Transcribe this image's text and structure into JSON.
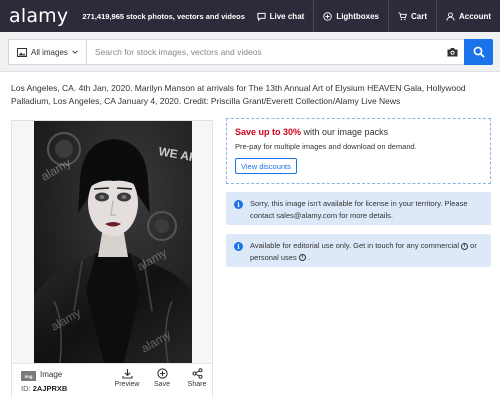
{
  "header": {
    "logo": "alamy",
    "tagline": "271,419,965 stock photos, vectors and videos",
    "links": [
      {
        "label": "Live chat",
        "icon": "chat-icon"
      },
      {
        "label": "Lightboxes",
        "icon": "plus-circle-icon"
      },
      {
        "label": "Cart",
        "icon": "cart-icon"
      },
      {
        "label": "Account",
        "icon": "user-icon"
      }
    ]
  },
  "search": {
    "category": "All images",
    "placeholder": "Search for stock images, vectors and videos",
    "value": ""
  },
  "caption": "Los Angeles, CA. 4th Jan, 2020. Marilyn Manson at arrivals for The 13th Annual Art of Elysium HEAVEN Gala, Hollywood Palladium, Los Angeles, CA January 4, 2020. Credit: Priscilla Grant/Everett Collection/Alamy Live News",
  "image_panel": {
    "type_badge": "img",
    "type_label": "Image",
    "id_label": "ID:",
    "id_value": "2AJPRXB",
    "watermark": "alamy",
    "backdrop_text": "WE ARE",
    "actions": [
      {
        "label": "Preview",
        "icon": "download-icon"
      },
      {
        "label": "Save",
        "icon": "plus-circle-icon"
      },
      {
        "label": "Share",
        "icon": "share-icon"
      }
    ]
  },
  "promo": {
    "highlight": "Save up to 30%",
    "title_rest": " with our image packs",
    "subtitle": "Pre-pay for multiple images and download on demand.",
    "button": "View discounts"
  },
  "notices": [
    {
      "text": "Sorry, this image isn't available for license in your territory. Please contact sales@alamy.com for more details."
    },
    {
      "text_before": "Available for editorial use only. Get in touch for any commercial ",
      "text_middle": " or personal uses ",
      "text_after": " ."
    }
  ],
  "colors": {
    "nav_bg": "#2d2b3a",
    "accent_blue": "#1a73e8",
    "promo_red": "#d0021b",
    "notice_bg": "#dde9f9"
  }
}
